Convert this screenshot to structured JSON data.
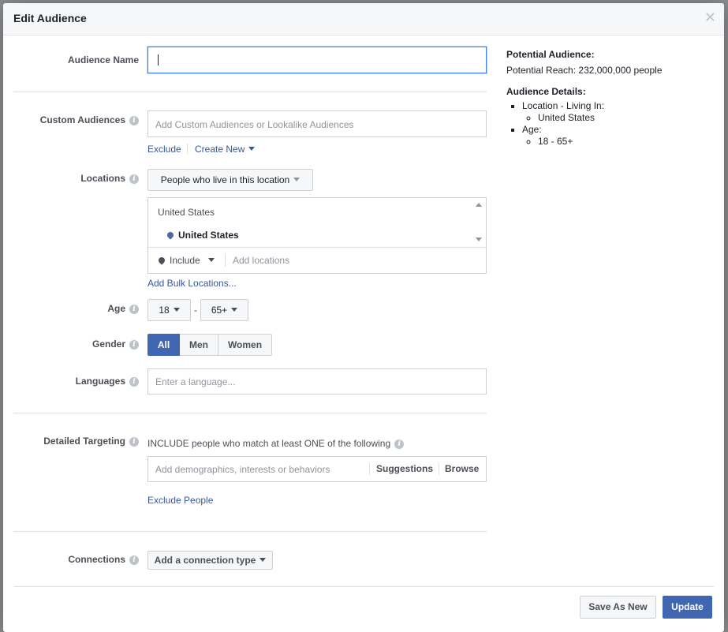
{
  "modal": {
    "title": "Edit Audience",
    "close_icon": "close-icon"
  },
  "form": {
    "audience_name": {
      "label": "Audience Name",
      "value": "",
      "placeholder": ""
    },
    "custom_audiences": {
      "label": "Custom Audiences",
      "placeholder": "Add Custom Audiences or Lookalike Audiences",
      "exclude_label": "Exclude",
      "create_new_label": "Create New"
    },
    "locations": {
      "label": "Locations",
      "mode_dropdown": "People who live in this location",
      "group_header": "United States",
      "selected_item": "United States",
      "include_dropdown": "Include",
      "add_placeholder": "Add locations",
      "bulk_link": "Add Bulk Locations..."
    },
    "age": {
      "label": "Age",
      "min": "18",
      "separator": "-",
      "max": "65+"
    },
    "gender": {
      "label": "Gender",
      "options": [
        "All",
        "Men",
        "Women"
      ],
      "selected": "All"
    },
    "languages": {
      "label": "Languages",
      "placeholder": "Enter a language..."
    },
    "detailed_targeting": {
      "label": "Detailed Targeting",
      "description": "INCLUDE people who match at least ONE of the following",
      "placeholder": "Add demographics, interests or behaviors",
      "suggestions_label": "Suggestions",
      "browse_label": "Browse",
      "exclude_people_label": "Exclude People"
    },
    "connections": {
      "label": "Connections",
      "dropdown": "Add a connection type"
    }
  },
  "summary": {
    "potential_audience_title": "Potential Audience:",
    "potential_reach": "Potential Reach: 232,000,000 people",
    "details_title": "Audience Details:",
    "location_heading": "Location - Living In:",
    "location_value": "United States",
    "age_heading": "Age:",
    "age_value": "18 - 65+"
  },
  "footer": {
    "save_as_new_label": "Save As New",
    "update_label": "Update"
  },
  "colors": {
    "primary": "#4267b2",
    "link": "#365899",
    "focus": "#4080ff"
  }
}
